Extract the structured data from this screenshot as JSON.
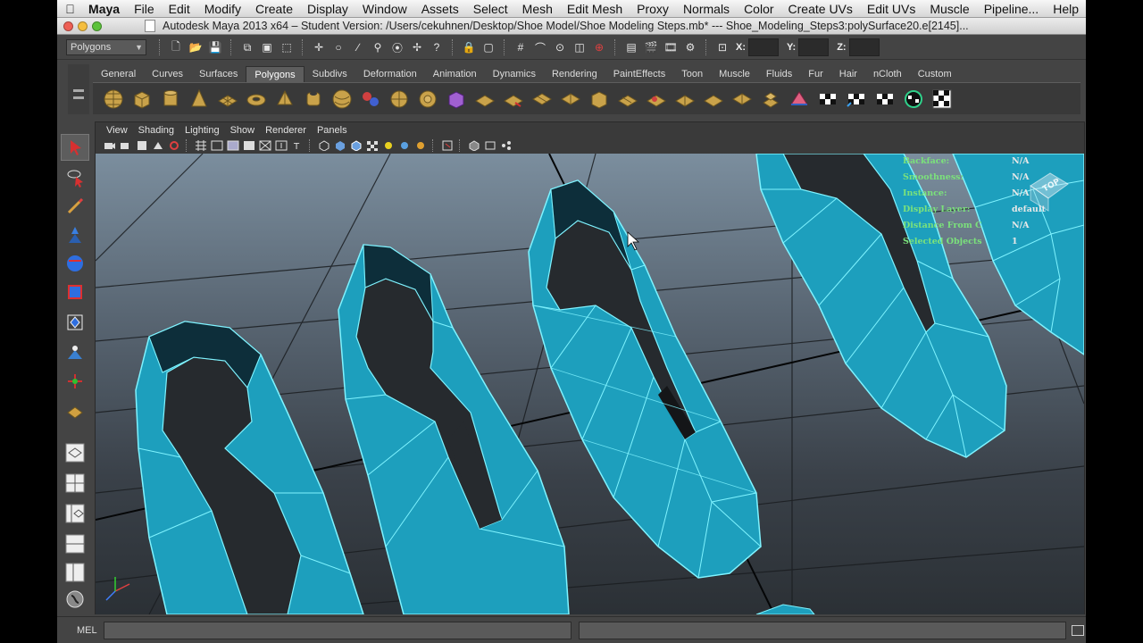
{
  "menubar": {
    "app": "Maya",
    "items": [
      "File",
      "Edit",
      "Modify",
      "Create",
      "Display",
      "Window",
      "Assets",
      "Select",
      "Mesh",
      "Edit Mesh",
      "Proxy",
      "Normals",
      "Color",
      "Create UVs",
      "Edit UVs",
      "Muscle",
      "Pipeline...",
      "Help"
    ]
  },
  "window": {
    "title": "Autodesk Maya 2013 x64 – Student Version: /Users/cekuhnen/Desktop/Shoe Model/Shoe Modeling Steps.mb*   ---   Shoe_Modeling_Steps3:polySurface20.e[2145]..."
  },
  "statusline": {
    "mode": "Polygons",
    "x_label": "X:",
    "y_label": "Y:",
    "z_label": "Z:"
  },
  "shelf": {
    "tabs": [
      "General",
      "Curves",
      "Surfaces",
      "Polygons",
      "Subdivs",
      "Deformation",
      "Animation",
      "Dynamics",
      "Rendering",
      "PaintEffects",
      "Toon",
      "Muscle",
      "Fluids",
      "Fur",
      "Hair",
      "nCloth",
      "Custom"
    ],
    "active_tab": "Polygons"
  },
  "panel": {
    "menus": [
      "View",
      "Shading",
      "Lighting",
      "Show",
      "Renderer",
      "Panels"
    ]
  },
  "hud": {
    "rows": [
      {
        "key": "Backface:",
        "value": "N/A"
      },
      {
        "key": "Smoothness:",
        "value": "N/A"
      },
      {
        "key": "Instance:",
        "value": "N/A"
      },
      {
        "key": "Display Layer:",
        "value": "default"
      },
      {
        "key": "Distance From C",
        "value": "N/A"
      },
      {
        "key": "Selected Objects",
        "value": "1"
      }
    ]
  },
  "viewcube": {
    "label": "TOP"
  },
  "cmdline": {
    "label": "MEL"
  },
  "colors": {
    "mesh": "#1fa6c4",
    "wire": "#7ff3ff",
    "hud": "#7be27b"
  }
}
